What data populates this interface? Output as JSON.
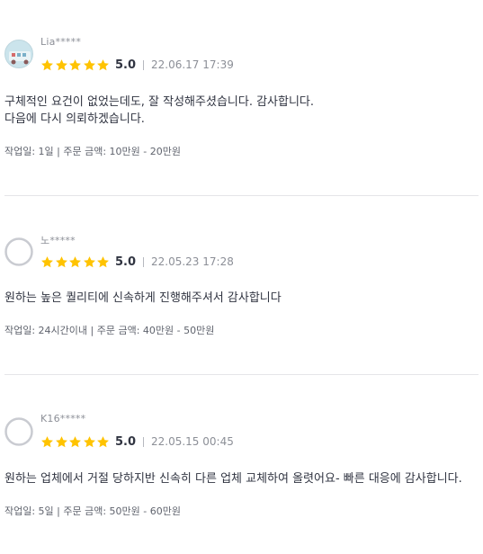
{
  "colors": {
    "star": "#ffc300",
    "divider": "#e5e5e8",
    "text": "#303441",
    "muted": "#8c8f97"
  },
  "reviews": [
    {
      "username": "Lia*****",
      "avatar": "photo-avatar",
      "score": "5.0",
      "stars": 5,
      "date": "22.06.17 17:39",
      "lines": [
        "구체적인 요건이 없었는데도, 잘 작성해주셨습니다. 감사합니다.",
        "다음에 다시 의뢰하겠습니다."
      ],
      "meta": "작업일: 1일 | 주문 금액: 10만원 - 20만원"
    },
    {
      "username": "노*****",
      "avatar": "default-user-icon",
      "score": "5.0",
      "stars": 5,
      "date": "22.05.23 17:28",
      "lines": [
        "원하는 높은 퀄리티에 신속하게 진행해주셔서 감사합니다"
      ],
      "meta": "작업일: 24시간이내 | 주문 금액: 40만원 - 50만원"
    },
    {
      "username": "K16*****",
      "avatar": "default-user-icon",
      "score": "5.0",
      "stars": 5,
      "date": "22.05.15 00:45",
      "lines": [
        "원하는 업체에서 거절 당하지반 신속히 다른 업체 교체하여 올렷어요- 빠른 대응에 감사합니다."
      ],
      "meta": "작업일: 5일 | 주문 금액: 50만원 - 60만원"
    }
  ]
}
